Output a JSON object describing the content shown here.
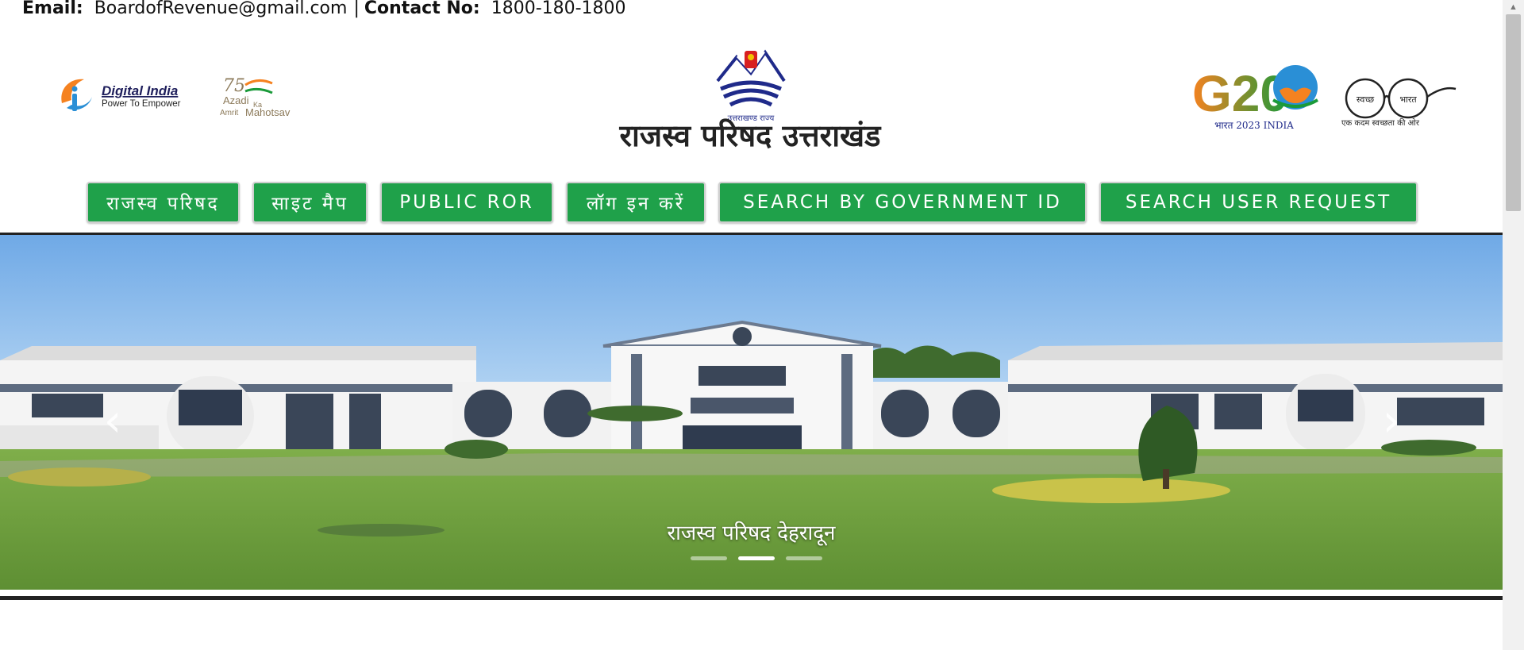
{
  "contact": {
    "email_label": "Email:",
    "email_value": "BoardofRevenue@gmail.com",
    "separator": "|",
    "contact_label": "Contact No:",
    "contact_value": "1800-180-1800"
  },
  "header": {
    "title": "राजस्व परिषद उत्तराखंड",
    "emblem_caption": "उत्तराखण्ड राज्य",
    "digital_india": {
      "line1": "Digital India",
      "line2": "Power To Empower"
    },
    "azadi": {
      "number": "75",
      "line1": "Azadi",
      "line2": "Ka",
      "line3": "Amrit",
      "line4": "Mahotsav"
    },
    "g20": {
      "text": "G20",
      "subtitle": "भारत 2023 INDIA"
    },
    "swachh": {
      "word1": "स्वच्छ",
      "word2": "भारत",
      "tagline": "एक कदम स्वच्छता की ओर"
    }
  },
  "nav": {
    "items": [
      {
        "label": "राजस्व परिषद"
      },
      {
        "label": "साइट मैप"
      },
      {
        "label": "PUBLIC ROR"
      },
      {
        "label": "लॉग इन करें"
      },
      {
        "label": "SEARCH BY GOVERNMENT ID"
      },
      {
        "label": "SEARCH USER REQUEST"
      }
    ]
  },
  "carousel": {
    "caption": "राजस्व परिषद देहरादून",
    "prev_icon": "‹",
    "next_icon": "›",
    "slide_count": 3,
    "active_slide": 2
  },
  "colors": {
    "nav_green": "#1fa14a",
    "title_dark": "#222222",
    "sky": "#8fc3ef",
    "grass": "#6fa33f"
  },
  "icons": [
    "digital-india-logo",
    "azadi-ka-amrit-mahotsav-logo",
    "uttarakhand-emblem",
    "g20-logo",
    "swachh-bharat-logo",
    "chevron-left-icon",
    "chevron-right-icon"
  ]
}
